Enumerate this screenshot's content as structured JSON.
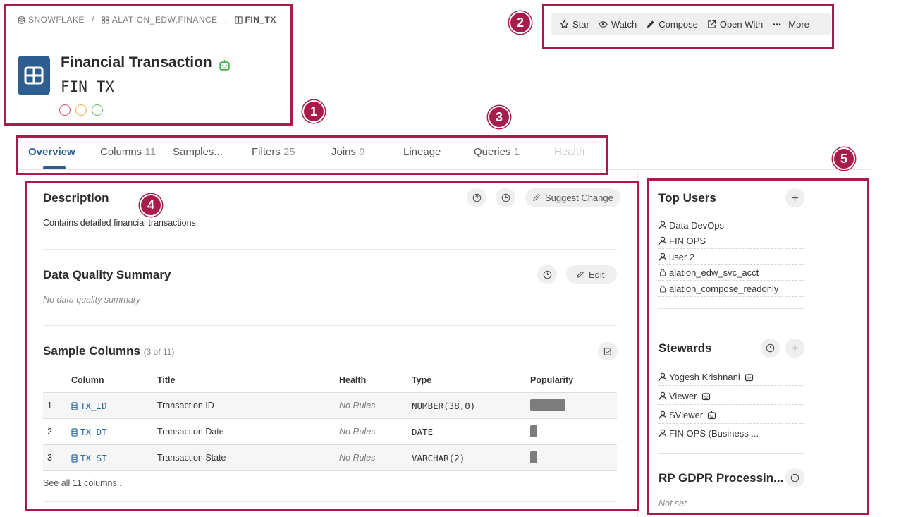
{
  "breadcrumb": {
    "items": [
      "SNOWFLAKE",
      "ALATION_EDW.FINANCE",
      "FIN_TX"
    ],
    "separators": [
      "/",
      "."
    ]
  },
  "header": {
    "title": "Financial Transaction",
    "name": "FIN_TX",
    "icon": "table-icon",
    "status_dots": [
      "#e0526b",
      "#e2b84a",
      "#5cbf66"
    ]
  },
  "toolbar": {
    "buttons": [
      {
        "label": "Star",
        "icon": "star-icon"
      },
      {
        "label": "Watch",
        "icon": "eye-icon"
      },
      {
        "label": "Compose",
        "icon": "pen-icon"
      },
      {
        "label": "Open With",
        "icon": "external-link-icon"
      },
      {
        "label": "More",
        "icon": "more-dots-icon"
      }
    ]
  },
  "tabs": [
    {
      "label": "Overview",
      "count": "",
      "state": "active"
    },
    {
      "label": "Columns",
      "count": "11",
      "state": "normal"
    },
    {
      "label": "Samples...",
      "count": "",
      "state": "normal"
    },
    {
      "label": "Filters",
      "count": "25",
      "state": "normal"
    },
    {
      "label": "Joins",
      "count": "9",
      "state": "normal"
    },
    {
      "label": "Lineage",
      "count": "",
      "state": "normal"
    },
    {
      "label": "Queries",
      "count": "1",
      "state": "normal"
    },
    {
      "label": "Health",
      "count": "",
      "state": "disabled"
    }
  ],
  "annotations": [
    "1",
    "2",
    "3",
    "4",
    "5"
  ],
  "description": {
    "title": "Description",
    "suggest_label": "Suggest Change",
    "text": "Contains detailed financial transactions."
  },
  "data_quality": {
    "title": "Data Quality Summary",
    "edit_label": "Edit",
    "text": "No data quality summary"
  },
  "sample_columns": {
    "title": "Sample Columns",
    "subtitle": "(3 of 11)",
    "headers": [
      "Column",
      "Title",
      "Health",
      "Type",
      "Popularity"
    ],
    "rows": [
      {
        "index": "1",
        "column": "TX_ID",
        "title": "Transaction ID",
        "health": "No Rules",
        "type": "NUMBER(38,0)",
        "popularity": 1.0
      },
      {
        "index": "2",
        "column": "TX_DT",
        "title": "Transaction Date",
        "health": "No Rules",
        "type": "DATE",
        "popularity": 0.2
      },
      {
        "index": "3",
        "column": "TX_ST",
        "title": "Transaction State",
        "health": "No Rules",
        "type": "VARCHAR(2)",
        "popularity": 0.2
      }
    ],
    "see_all": "See all 11 columns..."
  },
  "top_users": {
    "title": "Top Users",
    "items": [
      {
        "label": "Data DevOps",
        "icon": "user-icon"
      },
      {
        "label": "FIN OPS",
        "icon": "user-icon"
      },
      {
        "label": "user 2",
        "icon": "user-icon"
      },
      {
        "label": "alation_edw_svc_acct",
        "icon": "lock-icon"
      },
      {
        "label": "alation_compose_readonly",
        "icon": "lock-icon"
      }
    ]
  },
  "stewards": {
    "title": "Stewards",
    "items": [
      {
        "label": "Yogesh Krishnani",
        "bot": true
      },
      {
        "label": "Viewer",
        "bot": true
      },
      {
        "label": "SViewer",
        "bot": true
      },
      {
        "label": "FIN OPS (Business ...",
        "bot": false
      }
    ]
  },
  "gdpr": {
    "title": "RP GDPR Processin...",
    "value": "Not set"
  },
  "colors": {
    "accent": "#2e5d8f",
    "annotation": "#a81c4a",
    "link": "#2e6da4"
  }
}
